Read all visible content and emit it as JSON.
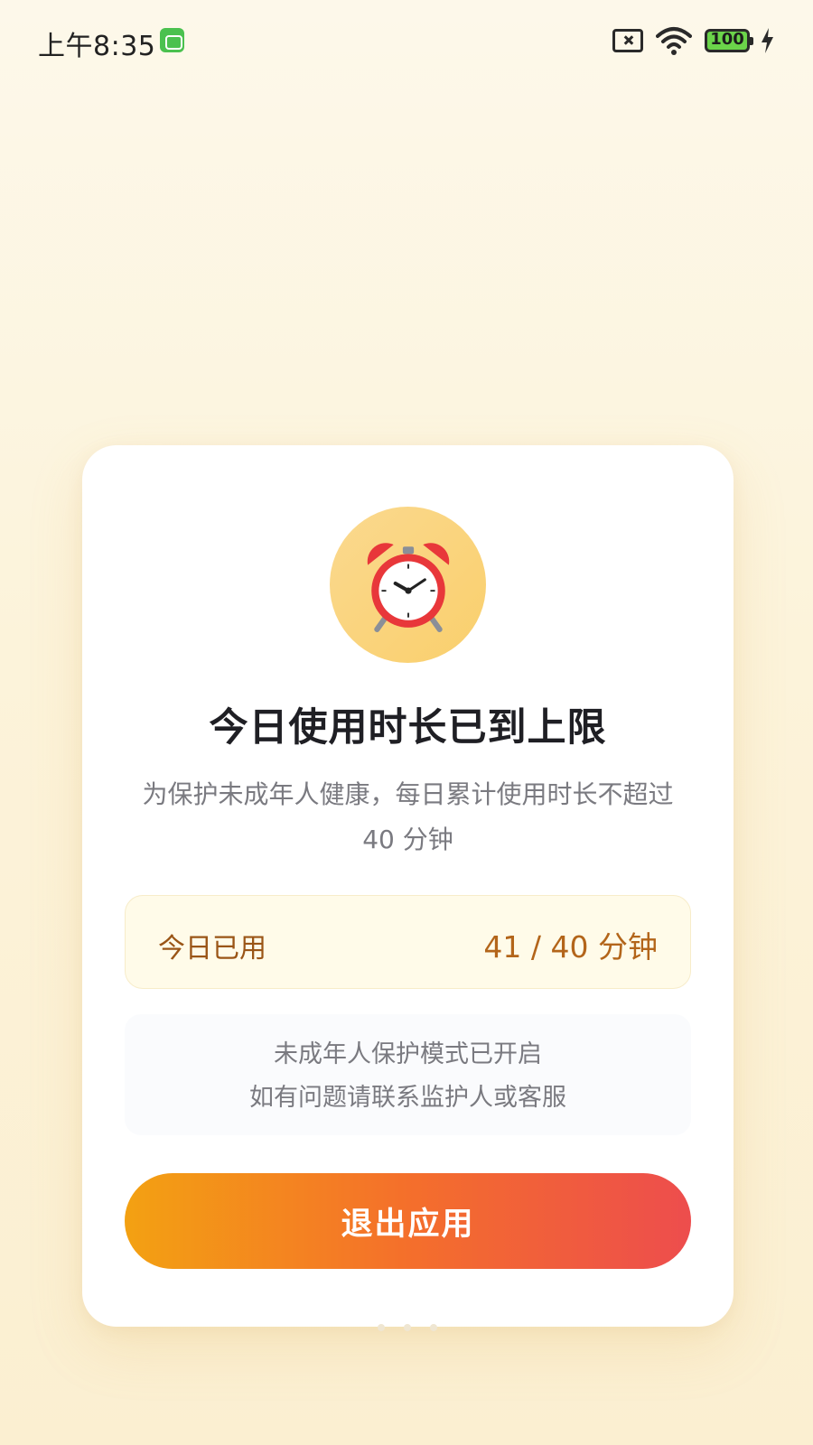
{
  "status_bar": {
    "time": "上午8:35",
    "battery_level": "100"
  },
  "card": {
    "icon": "alarm-clock-icon",
    "title": "今日使用时长已到上限",
    "description": "为保护未成年人健康，每日累计使用时长不超过 40 分钟",
    "usage": {
      "label": "今日已用",
      "value": "41 / 40 分钟"
    },
    "notice": {
      "line1": "未成年人保护模式已开启",
      "line2": "如有问题请联系监护人或客服"
    },
    "exit_button_label": "退出应用"
  },
  "colors": {
    "accent_start": "#f3a112",
    "accent_end": "#ed4d4d",
    "usage_text": "#b3651a"
  }
}
